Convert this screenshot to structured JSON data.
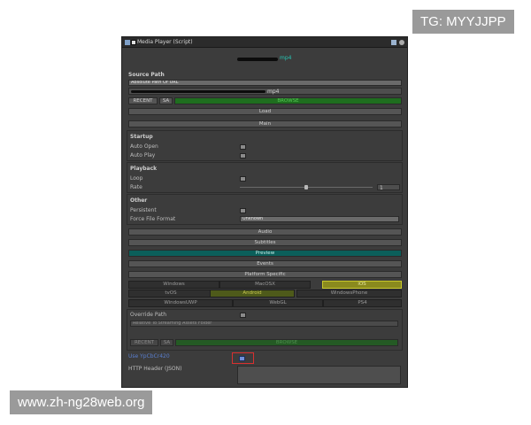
{
  "watermarks": {
    "top_right": "TG: MYYJJPP",
    "bottom_left": "www.zh-ng28web.org"
  },
  "colors": {
    "panel": "#3c3c3c",
    "accent_green": "#1f6e1f",
    "accent_teal": "#0b5f5a",
    "ios_yellow": "#8a8a1e",
    "android_olive": "#4e5a1a",
    "highlight_red": "#d83030"
  },
  "component": {
    "title": "Media Player (Script)",
    "file_suffix": "mp4"
  },
  "source_path": {
    "heading": "Source Path",
    "dropdown": "Absolute Path Or URL",
    "path_suffix": "mp4",
    "recent_label": "RECENT",
    "sa_label": "SA",
    "browse_label": "BROWSE",
    "load_label": "Load"
  },
  "main": {
    "section": "Main",
    "startup": {
      "heading": "Startup",
      "auto_open": "Auto Open",
      "auto_play": "Auto Play"
    },
    "playback": {
      "heading": "Playback",
      "loop": "Loop",
      "rate": "Rate",
      "rate_value": "1",
      "rate_fraction": 0.5
    },
    "other": {
      "heading": "Other",
      "persistent": "Persistent",
      "force_file_format": "Force File Format",
      "force_file_format_value": "Unknown"
    }
  },
  "sections": {
    "audio": "Audio",
    "subtitles": "Subtitles",
    "preview": "Preview",
    "events": "Events",
    "platform_specific": "Platform Specific"
  },
  "platforms": [
    "Windows",
    "MacOSX",
    "iOS",
    "tvOS",
    "Android",
    "WindowsPhone",
    "WindowsUWP",
    "WebGL",
    "PS4"
  ],
  "platform": {
    "override_path": "Override Path",
    "override_dropdown": "Relative To Streaming Assets Folder",
    "recent_label": "RECENT",
    "sa_label": "SA",
    "browse_label": "BROWSE",
    "use_ycbcr": "Use YpCbCr420",
    "http_header": "HTTP Header (JSON)"
  }
}
